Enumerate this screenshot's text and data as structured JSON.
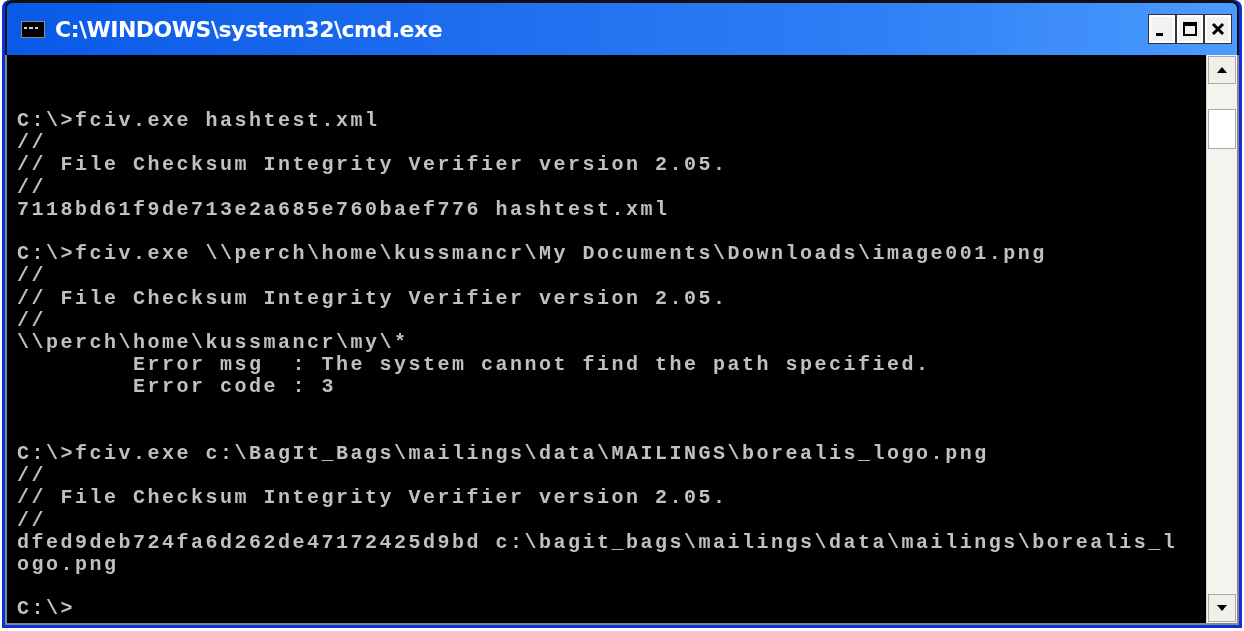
{
  "window": {
    "title": "C:\\WINDOWS\\system32\\cmd.exe"
  },
  "console_output": "C:\\>fciv.exe hashtest.xml\n//\n// File Checksum Integrity Verifier version 2.05.\n//\n7118bd61f9de713e2a685e760baef776 hashtest.xml\n\nC:\\>fciv.exe \\\\perch\\home\\kussmancr\\My Documents\\Downloads\\image001.png\n//\n// File Checksum Integrity Verifier version 2.05.\n//\n\\\\perch\\home\\kussmancr\\my\\*\n        Error msg  : The system cannot find the path specified.\n        Error code : 3\n\n\nC:\\>fciv.exe c:\\BagIt_Bags\\mailings\\data\\MAILINGS\\borealis_logo.png\n//\n// File Checksum Integrity Verifier version 2.05.\n//\ndfed9deb724fa6d262de47172425d9bd c:\\bagit_bags\\mailings\\data\\mailings\\borealis_l\nogo.png\n\nC:\\>"
}
